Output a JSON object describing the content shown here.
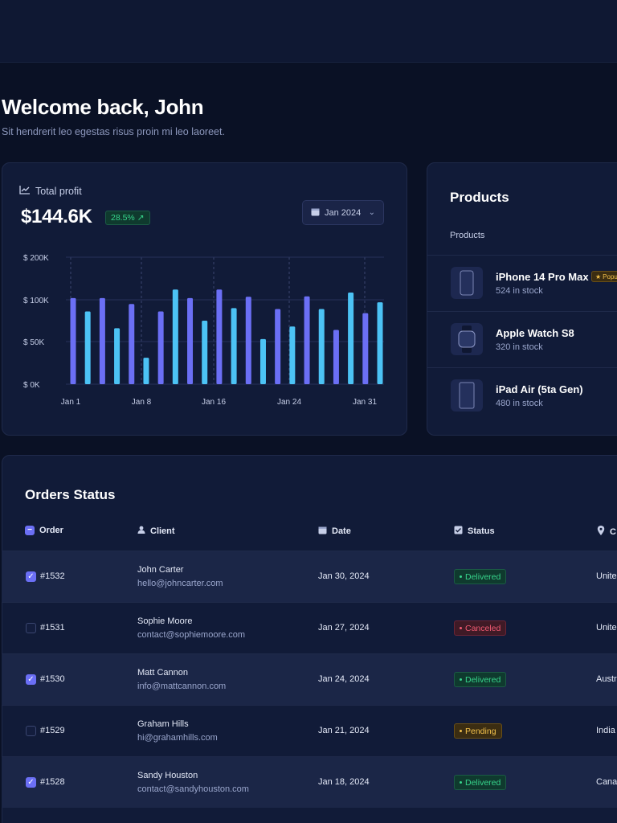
{
  "welcome": {
    "title": "Welcome back, John",
    "subtitle": "Sit hendrerit leo egestas risus proin mi leo laoreet."
  },
  "profit": {
    "label": "Total profit",
    "value": "$144.6K",
    "change": "28.5%",
    "date_filter": "Jan 2024"
  },
  "chart_data": {
    "type": "bar",
    "title": "",
    "y_ticks": [
      "$ 200K",
      "$ 100K",
      "$ 50K",
      "$ 0K"
    ],
    "x_ticks": [
      "Jan 1",
      "Jan 8",
      "Jan 16",
      "Jan 24",
      "Jan 31"
    ],
    "colors": [
      "#6b6ff5",
      "#4cc3f5"
    ],
    "values": [
      104,
      86,
      104,
      66,
      95,
      31,
      86,
      124,
      104,
      75,
      124,
      90,
      107,
      53,
      89,
      68,
      108,
      89,
      64,
      117,
      84,
      97
    ]
  },
  "products": {
    "title": "Products",
    "subtitle": "Products",
    "items": [
      {
        "name": "iPhone 14 Pro Max",
        "stock": "524 in stock",
        "badge": "Popular",
        "icon": "phone-icon"
      },
      {
        "name": "Apple Watch S8",
        "stock": "320 in stock",
        "icon": "watch-icon"
      },
      {
        "name": "iPad Air (5ta Gen)",
        "stock": "480 in stock",
        "icon": "tablet-icon"
      }
    ]
  },
  "orders": {
    "title": "Orders Status",
    "headers": {
      "order": "Order",
      "client": "Client",
      "date": "Date",
      "status": "Status",
      "country": "C"
    },
    "rows": [
      {
        "id": "#1532",
        "client": "John Carter",
        "email": "hello@johncarter.com",
        "date": "Jan 30, 2024",
        "status": "Delivered",
        "country": "Unite",
        "checked": true
      },
      {
        "id": "#1531",
        "client": "Sophie Moore",
        "email": "contact@sophiemoore.com",
        "date": "Jan 27, 2024",
        "status": "Canceled",
        "country": "Unite",
        "checked": false
      },
      {
        "id": "#1530",
        "client": "Matt Cannon",
        "email": "info@mattcannon.com",
        "date": "Jan 24, 2024",
        "status": "Delivered",
        "country": "Austr",
        "checked": true
      },
      {
        "id": "#1529",
        "client": "Graham Hills",
        "email": "hi@grahamhills.com",
        "date": "Jan 21, 2024",
        "status": "Pending",
        "country": "India",
        "checked": false
      },
      {
        "id": "#1528",
        "client": "Sandy Houston",
        "email": "contact@sandyhouston.com",
        "date": "Jan 18, 2024",
        "status": "Delivered",
        "country": "Cana",
        "checked": true
      }
    ]
  }
}
